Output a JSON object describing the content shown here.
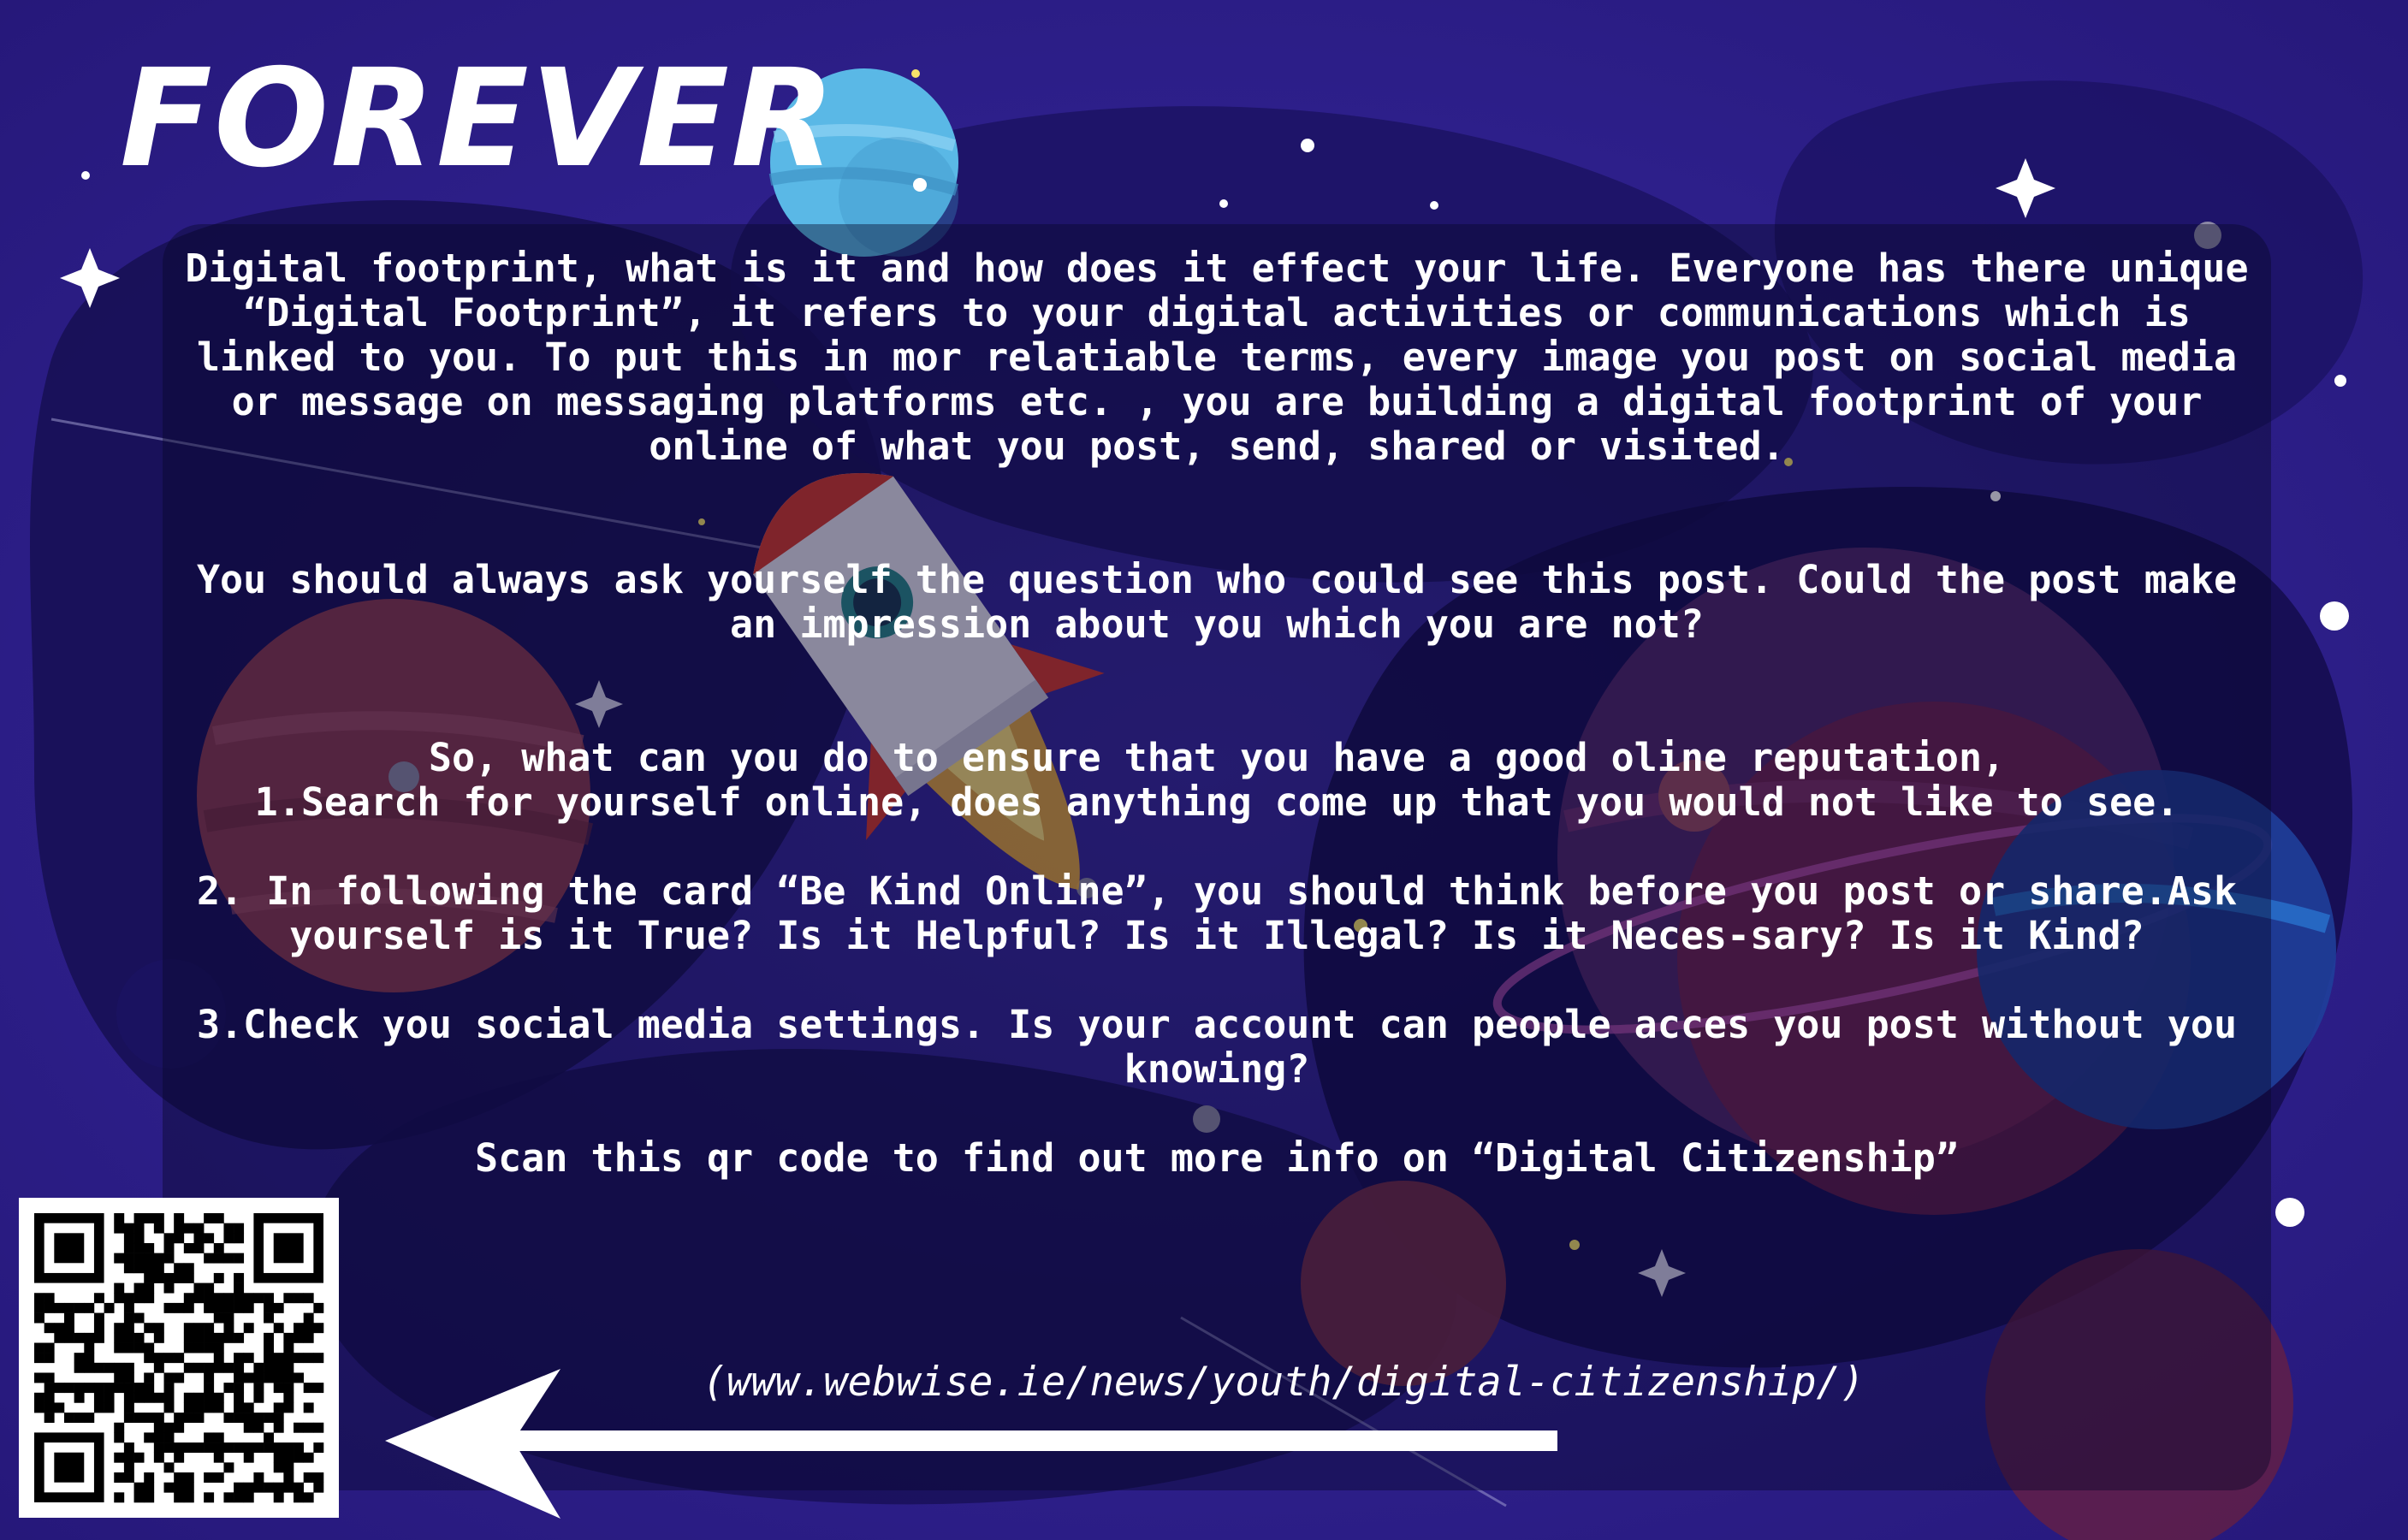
{
  "title": "FOREVER",
  "paragraphs": {
    "intro": "Digital footprint, what is it and how does it effect your life. Everyone has there unique “Digital Footprint”, it refers to your digital activities or communications which is linked to you. To put this in mor relatiable terms, every image you post on social media or message on messaging platforms etc. , you are building a digital footprint of your online of what you post, send, shared or visited.",
    "question": "You should always ask yourself the question who could see this post. Could the post make an impression about you which you are not?",
    "reputation_intro": "So, what can you do to ensure that you have a good oline reputation,",
    "tip1": "1.Search for yourself online, does anything come up that you would not like to see.",
    "tip2": "2. In following the card “Be Kind Online”, you should think before you post or share.Ask yourself is it True? Is it Helpful? Is it Illegal? Is it Neces-sary? Is it Kind?",
    "tip3": "3.Check you social media settings. Is your account can people acces you post without you knowing?",
    "scan": "Scan this qr code to find out more info on “Digital Citizenship”"
  },
  "url": "(www.webwise.ie/news/youth/digital-citizenship/)",
  "icons": {
    "qr": "qr-code",
    "arrow": "left-arrow-icon",
    "rocket": "rocket-icon"
  },
  "colors": {
    "background": "#2e1f8c",
    "text": "#ffffff",
    "planet_blue": "#5ab8e6",
    "planet_red": "#8a3a52"
  }
}
